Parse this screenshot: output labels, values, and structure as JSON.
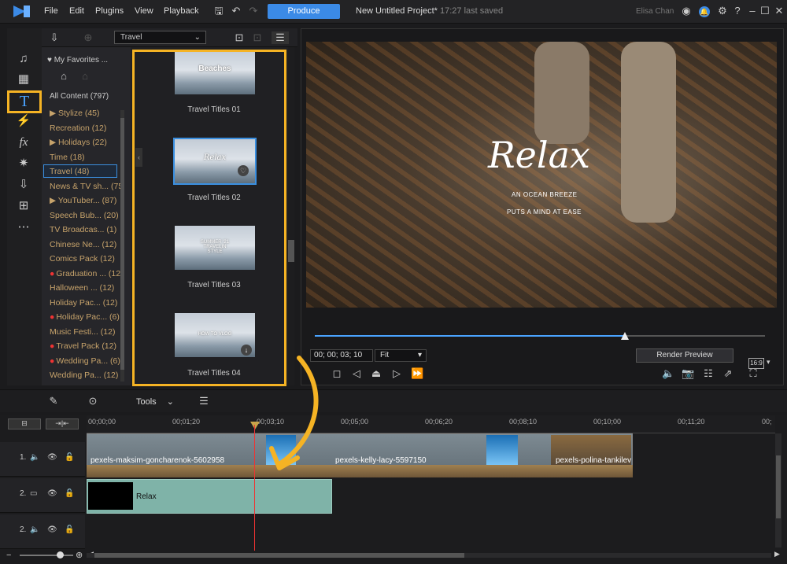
{
  "app": {
    "logo": "powerdirector-logo",
    "accent": "#3b8ae6",
    "highlight": "#f5b324"
  },
  "menu": [
    "File",
    "Edit",
    "Plugins",
    "View",
    "Playback"
  ],
  "produce_label": "Produce",
  "project": {
    "name": "New Untitled Project*",
    "status": "17:27 last saved"
  },
  "user": "Elisa Chan",
  "library": {
    "dropdown_value": "Travel",
    "favorites_label": "My Favorites ...",
    "all_content": "All Content (797)",
    "categories": [
      {
        "label": "Stylize",
        "count": "(45)",
        "arrow": "▶ "
      },
      {
        "label": "Recreation",
        "count": "(12)"
      },
      {
        "label": "Holidays",
        "count": "(22)",
        "arrow": "▶ "
      },
      {
        "label": "Time",
        "count": "(18)"
      },
      {
        "label": "Travel",
        "count": "(48)"
      },
      {
        "label": "News & TV sh...",
        "count": "(75"
      },
      {
        "label": "YouTuber...",
        "count": "(87)",
        "arrow": "▶ "
      },
      {
        "label": "Speech Bub...",
        "count": "(20)"
      },
      {
        "label": "TV Broadcas...",
        "count": "(1)"
      },
      {
        "label": "Chinese Ne...",
        "count": "(12)"
      },
      {
        "label": "Comics Pack",
        "count": "(12)"
      },
      {
        "label": "Graduation ...",
        "count": "(12)",
        "dot": true
      },
      {
        "label": "Halloween ...",
        "count": "(12)"
      },
      {
        "label": "Holiday Pac...",
        "count": "(12)"
      },
      {
        "label": "Holiday Pac...",
        "count": "(6)",
        "dot": true
      },
      {
        "label": "Music Festi...",
        "count": "(12)"
      },
      {
        "label": "Travel Pack",
        "count": "(12)",
        "dot": true
      },
      {
        "label": "Wedding Pa...",
        "count": "(6)",
        "dot": true
      },
      {
        "label": "Wedding Pa...",
        "count": "(12)"
      }
    ],
    "templates": [
      {
        "label": "Travel Titles 01",
        "thumb_text": "Beaches"
      },
      {
        "label": "Travel Titles 02",
        "thumb_text": "Relax"
      },
      {
        "label": "Travel Titles 03",
        "thumb_text": "SUMMER '21 TRAVELIN STYLE"
      },
      {
        "label": "Travel Titles 04",
        "thumb_text": "HOW TO VLOG"
      }
    ]
  },
  "preview": {
    "title": "Relax",
    "sub1": "AN OCEAN BREEZE",
    "sub2": "PUTS A MIND AT EASE",
    "timecode": "00; 00; 03; 10",
    "fit": "Fit",
    "render_label": "Render Preview",
    "ratio": "16:9",
    "progress": 0.69
  },
  "toolbar": {
    "tools_label": "Tools"
  },
  "timeline": {
    "ruler": [
      "00;00;00",
      "00;01;20",
      "00;03;10",
      "00;05;00",
      "00;06;20",
      "00;08;10",
      "00;10;00",
      "00;11;20",
      "00;"
    ],
    "tracks": [
      {
        "label": "1."
      },
      {
        "label": "2."
      },
      {
        "label": "2."
      }
    ],
    "clips": [
      "pexels-maksim-goncharenok-5602958",
      "pexels-kelly-lacy-5597150",
      "pexels-polina-tankilevitch"
    ],
    "title_clip": "Relax"
  }
}
